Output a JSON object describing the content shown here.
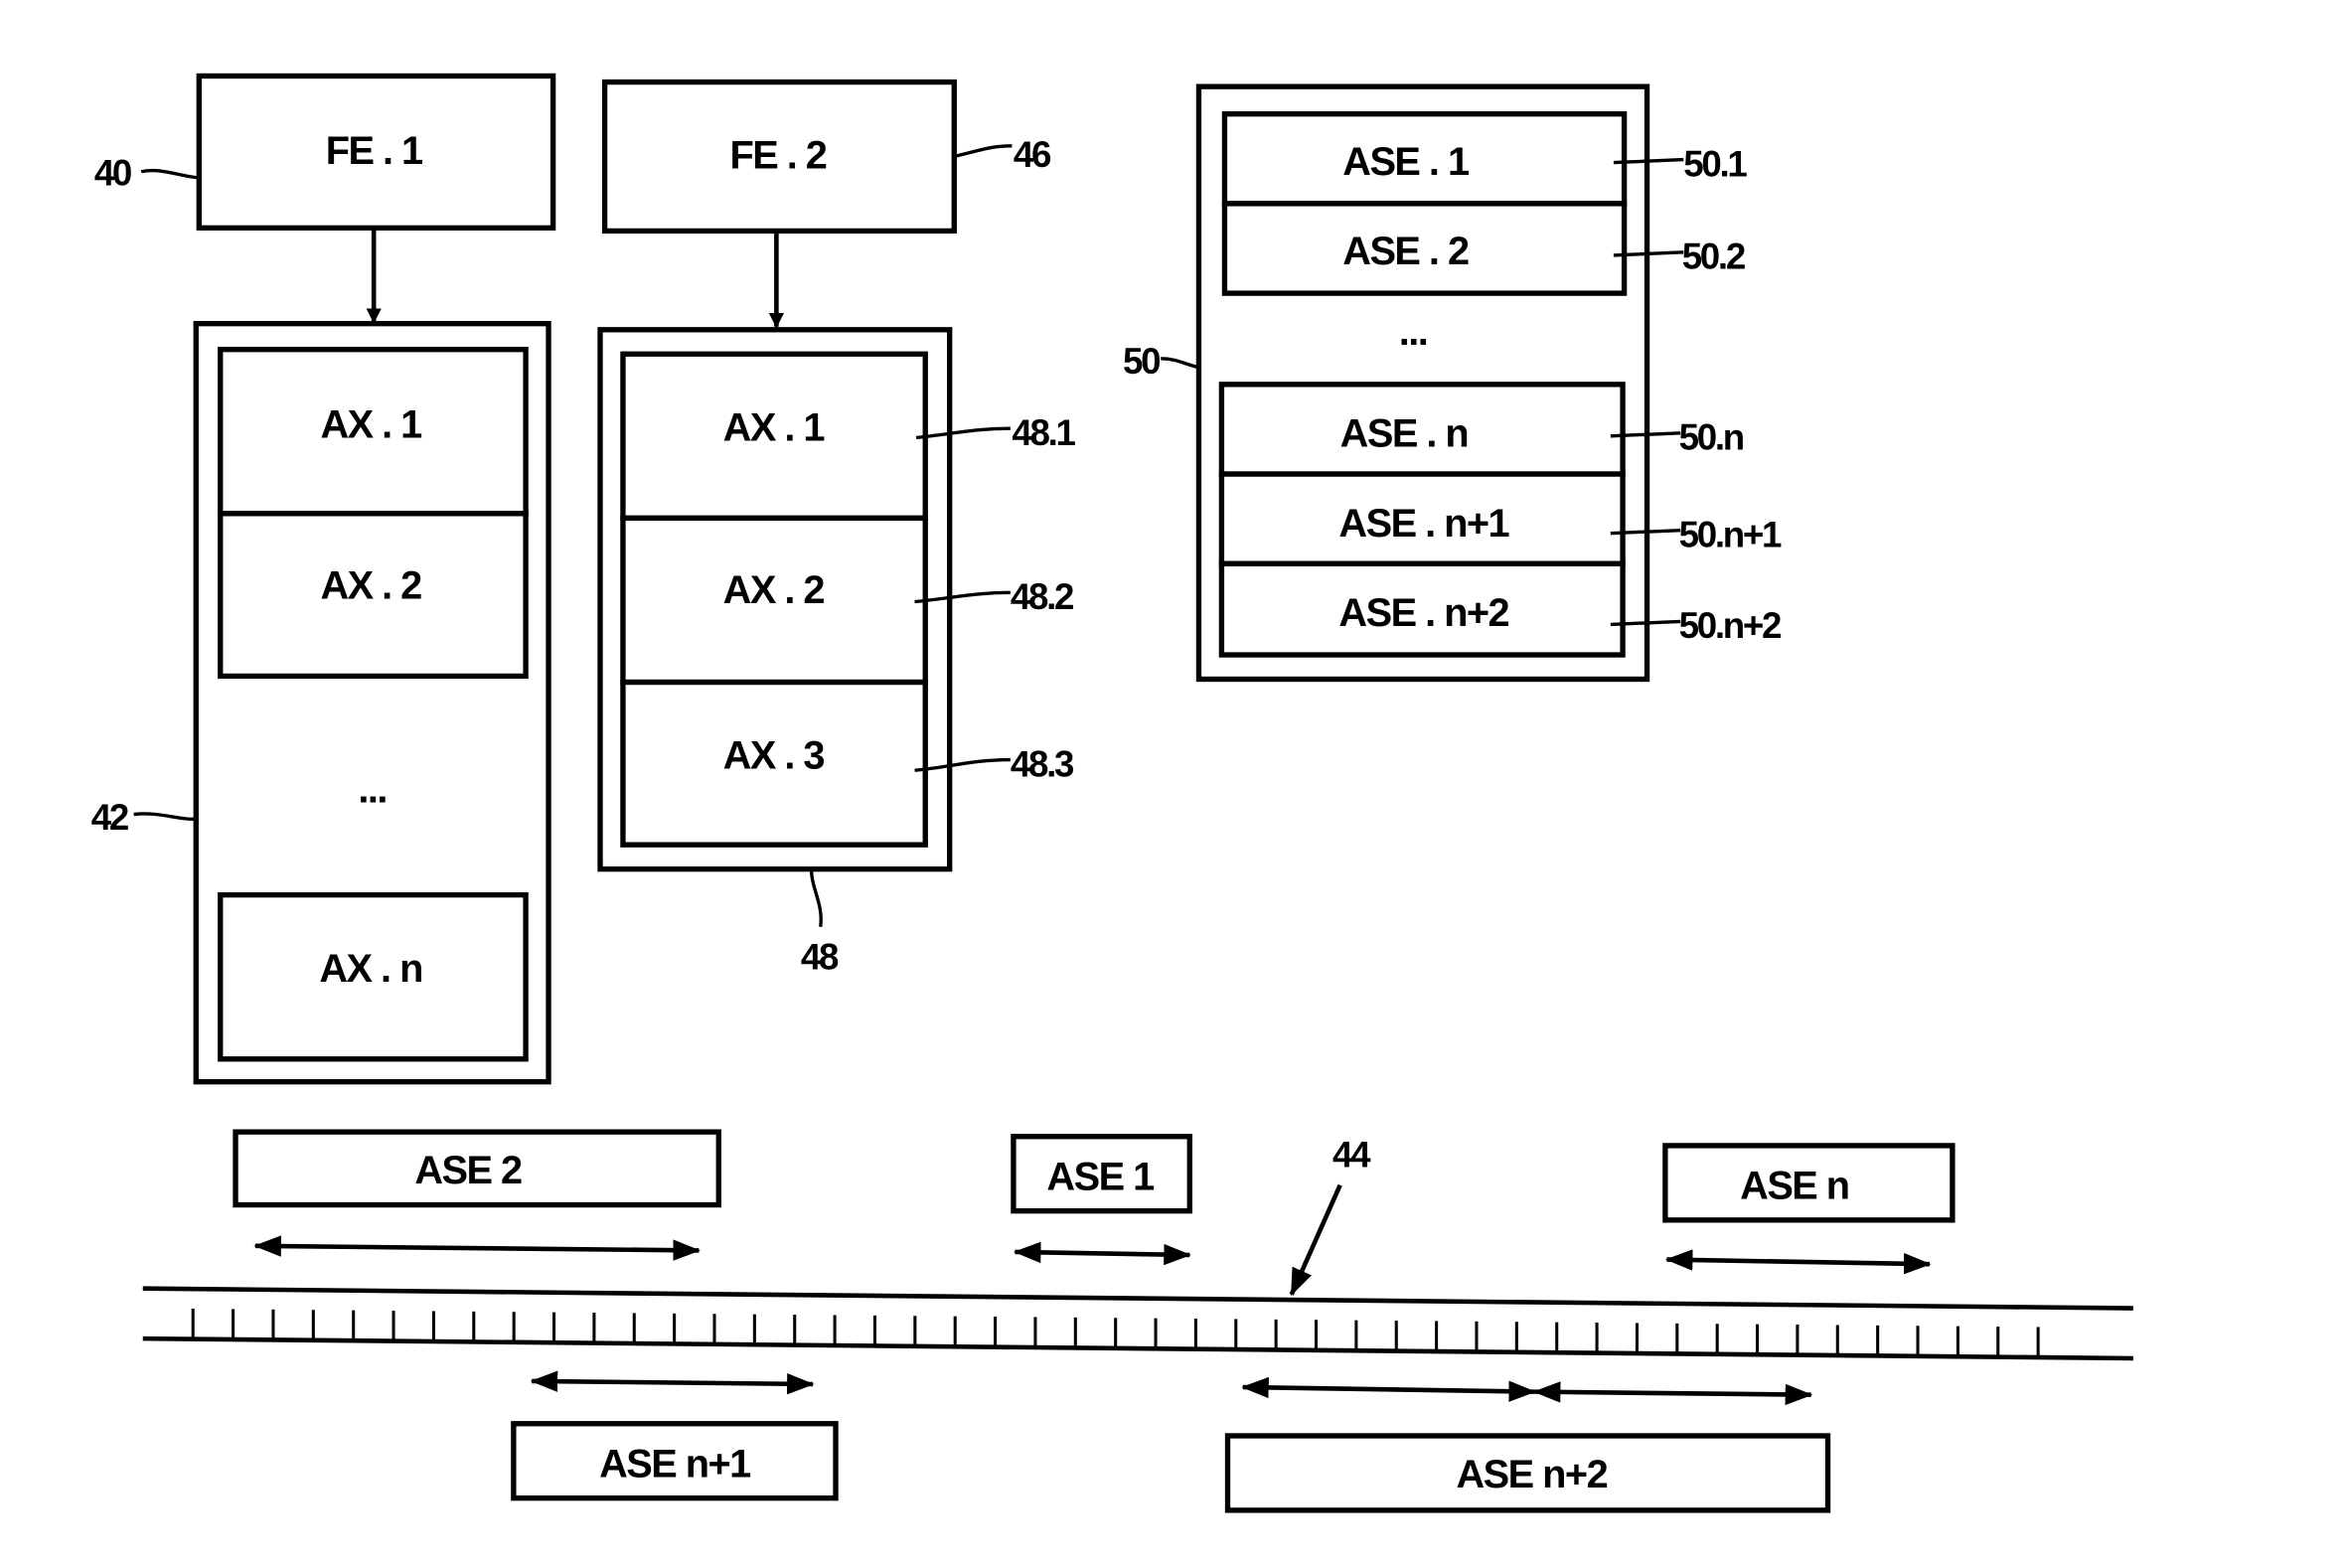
{
  "figure": {
    "fe_blocks": [
      {
        "label": "FE . 1",
        "ref": "40"
      },
      {
        "label": "FE . 2",
        "ref": "46"
      }
    ],
    "ax_group_1": {
      "ref": "42",
      "items": [
        "AX . 1",
        "AX . 2",
        "AX . n"
      ],
      "ellipsis": "..."
    },
    "ax_group_2": {
      "ref": "48",
      "items": [
        {
          "label": "AX . 1",
          "ref": "48.1"
        },
        {
          "label": "AX . 2",
          "ref": "48.2"
        },
        {
          "label": "AX . 3",
          "ref": "48.3"
        }
      ]
    },
    "ase_group": {
      "ref": "50",
      "ellipsis": "...",
      "items": [
        {
          "label": "ASE . 1",
          "ref": "50.1"
        },
        {
          "label": "ASE . 2",
          "ref": "50.2"
        },
        {
          "label": "ASE . n",
          "ref": "50.n"
        },
        {
          "label": "ASE . n+1",
          "ref": "50.n+1"
        },
        {
          "label": "ASE . n+2",
          "ref": "50.n+2"
        }
      ]
    },
    "bus": {
      "ref": "44"
    },
    "bus_segments": [
      {
        "label": "ASE 2"
      },
      {
        "label": "ASE 1"
      },
      {
        "label": "ASE n"
      },
      {
        "label": "ASE n+1"
      },
      {
        "label": "ASE n+2"
      }
    ]
  }
}
